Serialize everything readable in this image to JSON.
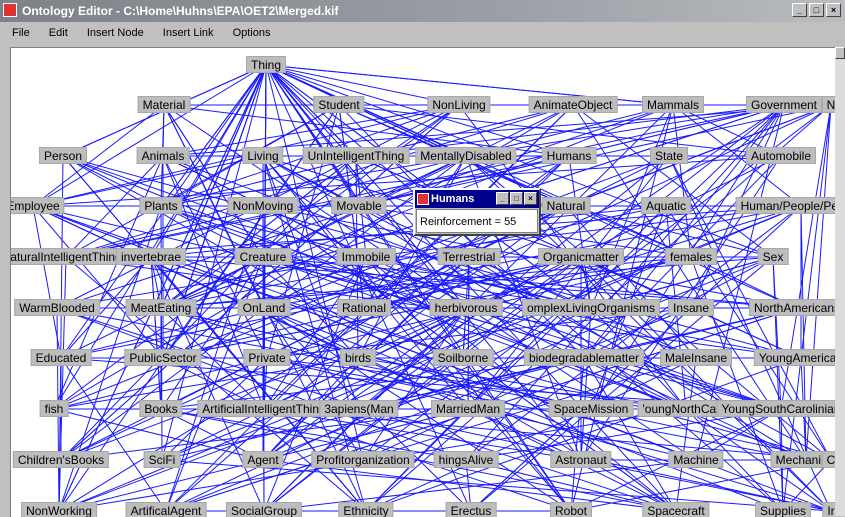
{
  "window": {
    "title": "Ontology Editor - C:\\Home\\Huhns\\EPA\\OET2\\Merged.kif"
  },
  "menu": [
    "File",
    "Edit",
    "Insert Node",
    "Insert Link",
    "Options"
  ],
  "colors": {
    "edge": "#1a1aff",
    "node": "#bdbdbd",
    "popup_title": "#00008b"
  },
  "nodes": [
    {
      "label": "Thing"
    },
    {
      "label": "Material"
    },
    {
      "label": "Student"
    },
    {
      "label": "NonLiving"
    },
    {
      "label": "AnimateObject"
    },
    {
      "label": "Mammals"
    },
    {
      "label": "Government"
    },
    {
      "label": "N"
    },
    {
      "label": "Person"
    },
    {
      "label": "Animals"
    },
    {
      "label": "Living"
    },
    {
      "label": "UnIntelligentThing"
    },
    {
      "label": "MentallyDisabled"
    },
    {
      "label": "Humans"
    },
    {
      "label": "State"
    },
    {
      "label": "Automobile"
    },
    {
      "label": "Employee"
    },
    {
      "label": "Plants"
    },
    {
      "label": "NonMoving"
    },
    {
      "label": "Movable"
    },
    {
      "label": "Natural"
    },
    {
      "label": "Aquatic"
    },
    {
      "label": "Human/People/Person"
    },
    {
      "label": "aturalIntelligentThing"
    },
    {
      "label": "invertebrae"
    },
    {
      "label": "Creature"
    },
    {
      "label": "Immobile"
    },
    {
      "label": "Terrestrial"
    },
    {
      "label": "Organicmatter"
    },
    {
      "label": "females"
    },
    {
      "label": "Sex"
    },
    {
      "label": "WarmBlooded"
    },
    {
      "label": "MeatEating"
    },
    {
      "label": "OnLand"
    },
    {
      "label": "Rational"
    },
    {
      "label": "herbivorous"
    },
    {
      "label": "omplexLivingOrganisms"
    },
    {
      "label": "Insane"
    },
    {
      "label": "NorthAmericans"
    },
    {
      "label": "Educated"
    },
    {
      "label": "PublicSector"
    },
    {
      "label": "Private"
    },
    {
      "label": "birds"
    },
    {
      "label": "Soilborne"
    },
    {
      "label": "biodegradablematter"
    },
    {
      "label": "MaleInsane"
    },
    {
      "label": "YoungAmerican"
    },
    {
      "label": "fish"
    },
    {
      "label": "Books"
    },
    {
      "label": "ArtificialIntelligentThing"
    },
    {
      "label": "3apiens(Man"
    },
    {
      "label": "MarriedMan"
    },
    {
      "label": "SpaceMission"
    },
    {
      "label": "'oungNorthCarol"
    },
    {
      "label": "YoungSouthCarolinian"
    },
    {
      "label": "Children'sBooks"
    },
    {
      "label": "SciFi"
    },
    {
      "label": "Agent"
    },
    {
      "label": "Profitorganization"
    },
    {
      "label": "hingsAlive"
    },
    {
      "label": "Astronaut"
    },
    {
      "label": "Machine"
    },
    {
      "label": "Mechanical"
    },
    {
      "label": "C"
    },
    {
      "label": "NonWorking"
    },
    {
      "label": "ArtificalAgent"
    },
    {
      "label": "SocialGroup"
    },
    {
      "label": "Ethnicity"
    },
    {
      "label": "Erectus"
    },
    {
      "label": "Robot"
    },
    {
      "label": "Spacecraft"
    },
    {
      "label": "Supplies"
    },
    {
      "label": "Ir"
    }
  ],
  "popup": {
    "title": "Humans",
    "text": "Reinforcement = 55"
  }
}
